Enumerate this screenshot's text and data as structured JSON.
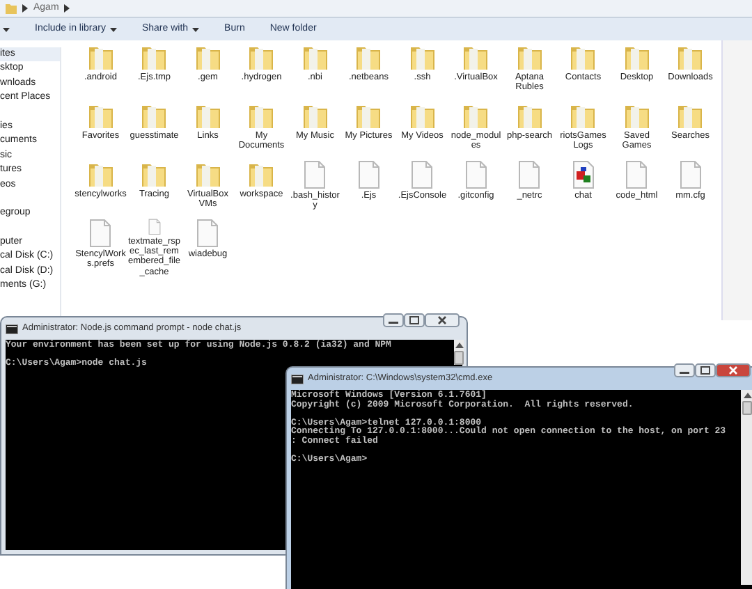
{
  "explorer": {
    "breadcrumb": "Agam",
    "toolbar": [
      {
        "label": "Include in library",
        "dropdown": true
      },
      {
        "label": "Share with",
        "dropdown": true
      },
      {
        "label": "Burn",
        "dropdown": false
      },
      {
        "label": "New folder",
        "dropdown": false
      }
    ],
    "sidebar_groups": [
      [
        {
          "label": "ites",
          "selected": true
        },
        {
          "label": "sktop",
          "selected": false
        },
        {
          "label": "wnloads",
          "selected": false
        },
        {
          "label": "cent Places",
          "selected": false
        }
      ],
      [
        {
          "label": "ies",
          "selected": false
        },
        {
          "label": "cuments",
          "selected": false
        },
        {
          "label": "sic",
          "selected": false
        },
        {
          "label": "tures",
          "selected": false
        },
        {
          "label": "eos",
          "selected": false
        }
      ],
      [
        {
          "label": "egroup",
          "selected": false
        }
      ],
      [
        {
          "label": "puter",
          "selected": false
        },
        {
          "label": "cal Disk (C:)",
          "selected": false
        },
        {
          "label": "cal Disk (D:)",
          "selected": false
        },
        {
          "label": "ments (G:)",
          "selected": false
        }
      ]
    ],
    "items": [
      {
        "name": ".android",
        "kind": "folder"
      },
      {
        "name": ".Ejs.tmp",
        "kind": "folder"
      },
      {
        "name": ".gem",
        "kind": "folder"
      },
      {
        "name": ".hydrogen",
        "kind": "folder"
      },
      {
        "name": ".nbi",
        "kind": "folder"
      },
      {
        "name": ".netbeans",
        "kind": "folder"
      },
      {
        "name": ".ssh",
        "kind": "folder"
      },
      {
        "name": ".VirtualBox",
        "kind": "folder"
      },
      {
        "name": "Aptana Rubles",
        "kind": "folder"
      },
      {
        "name": "Contacts",
        "kind": "folder"
      },
      {
        "name": "Desktop",
        "kind": "folder"
      },
      {
        "name": "Downloads",
        "kind": "folder"
      },
      {
        "name": "Favorites",
        "kind": "folder"
      },
      {
        "name": "guesstimate",
        "kind": "folder"
      },
      {
        "name": "Links",
        "kind": "folder"
      },
      {
        "name": "My Documents",
        "kind": "folder"
      },
      {
        "name": "My Music",
        "kind": "folder"
      },
      {
        "name": "My Pictures",
        "kind": "folder"
      },
      {
        "name": "My Videos",
        "kind": "folder"
      },
      {
        "name": "node_modules",
        "kind": "folder"
      },
      {
        "name": "php-search",
        "kind": "folder"
      },
      {
        "name": "riotsGames Logs",
        "kind": "folder"
      },
      {
        "name": "Saved Games",
        "kind": "folder"
      },
      {
        "name": "Searches",
        "kind": "folder"
      },
      {
        "name": "stencylworks",
        "kind": "folder"
      },
      {
        "name": "Tracing",
        "kind": "folder"
      },
      {
        "name": "VirtualBox VMs",
        "kind": "folder"
      },
      {
        "name": "workspace",
        "kind": "folder"
      },
      {
        "name": ".bash_history",
        "kind": "file"
      },
      {
        "name": ".Ejs",
        "kind": "file"
      },
      {
        "name": ".EjsConsole",
        "kind": "file"
      },
      {
        "name": ".gitconfig",
        "kind": "file"
      },
      {
        "name": "_netrc",
        "kind": "file"
      },
      {
        "name": "chat",
        "kind": "app"
      },
      {
        "name": "code_html",
        "kind": "file"
      },
      {
        "name": "mm.cfg",
        "kind": "file"
      },
      {
        "name": "StencylWorks.prefs",
        "kind": "file"
      },
      {
        "name": "textmate_rspec_last_remembered_file_cache",
        "kind": "file"
      },
      {
        "name": "wiadebug",
        "kind": "file"
      }
    ]
  },
  "consoles": [
    {
      "title": "Administrator: Node.js command prompt - node  chat.js",
      "active": false,
      "blocks": [
        [
          "Your environment has been set up for using Node.js 0.8.2 (ia32) and NPM"
        ],
        [
          "C:\\Users\\Agam>node chat.js"
        ]
      ]
    },
    {
      "title": "Administrator: C:\\Windows\\system32\\cmd.exe",
      "active": true,
      "blocks": [
        [
          "Microsoft Windows [Version 6.1.7601]",
          "Copyright (c) 2009 Microsoft Corporation.  All rights reserved."
        ],
        [
          "C:\\Users\\Agam>telnet 127.0.0.1:8000",
          "Connecting To 127.0.0.1:8000...Could not open connection to the host, on port 23",
          ": Connect failed"
        ],
        [
          "C:\\Users\\Agam>"
        ]
      ]
    }
  ]
}
